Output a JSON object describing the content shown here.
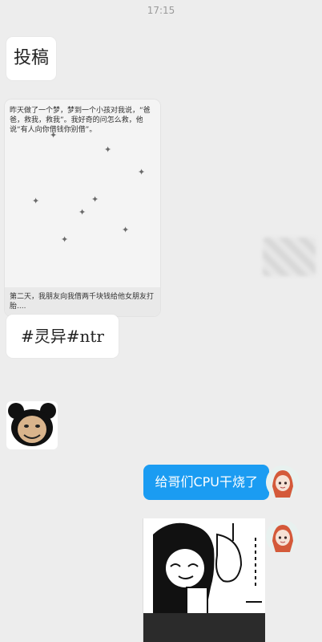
{
  "status": {
    "time": "17:15"
  },
  "messages": {
    "m1": {
      "text": "投稿"
    },
    "m2": {
      "top_text": "昨天做了一个梦，梦到一个小孩对我说，“爸爸，救我，救我”。我好奇的问怎么救，他说“有人向你借钱你别借”。",
      "bottom_text": "第二天，我朋友向我借两千块钱给他女朋友打胎....",
      "figure_glyph": "✦"
    },
    "m3": {
      "text": "#灵异#ntr"
    },
    "m5": {
      "text": "给哥们CPU干烧了"
    }
  },
  "colors": {
    "bg": "#ededed",
    "bubble_self": "#1b9cf2",
    "bubble_other": "#ffffff"
  },
  "icons": {
    "left_avatar": "panda-meme-sticker",
    "right_avatar": "red-haired-anime-girl"
  }
}
